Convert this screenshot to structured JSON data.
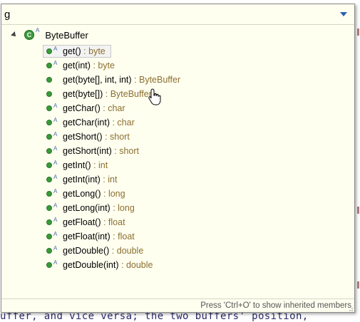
{
  "filter": {
    "value": "g"
  },
  "tree": {
    "root_label": "ByteBuffer",
    "items": [
      {
        "name": "get()",
        "sep": " : ",
        "type": "byte",
        "static": false,
        "selected": true
      },
      {
        "name": "get(int)",
        "sep": " : ",
        "type": "byte",
        "static": false,
        "selected": false
      },
      {
        "name": "get(byte[], int, int)",
        "sep": " : ",
        "type": "ByteBuffer",
        "static": true,
        "selected": false
      },
      {
        "name": "get(byte[])",
        "sep": " : ",
        "type": "ByteBuffer",
        "static": true,
        "selected": false
      },
      {
        "name": "getChar()",
        "sep": " : ",
        "type": "char",
        "static": false,
        "selected": false
      },
      {
        "name": "getChar(int)",
        "sep": " : ",
        "type": "char",
        "static": false,
        "selected": false
      },
      {
        "name": "getShort()",
        "sep": " : ",
        "type": "short",
        "static": false,
        "selected": false
      },
      {
        "name": "getShort(int)",
        "sep": " : ",
        "type": "short",
        "static": false,
        "selected": false
      },
      {
        "name": "getInt()",
        "sep": " : ",
        "type": "int",
        "static": false,
        "selected": false
      },
      {
        "name": "getInt(int)",
        "sep": " : ",
        "type": "int",
        "static": false,
        "selected": false
      },
      {
        "name": "getLong()",
        "sep": " : ",
        "type": "long",
        "static": false,
        "selected": false
      },
      {
        "name": "getLong(int)",
        "sep": " : ",
        "type": "long",
        "static": false,
        "selected": false
      },
      {
        "name": "getFloat()",
        "sep": " : ",
        "type": "float",
        "static": false,
        "selected": false
      },
      {
        "name": "getFloat(int)",
        "sep": " : ",
        "type": "float",
        "static": false,
        "selected": false
      },
      {
        "name": "getDouble()",
        "sep": " : ",
        "type": "double",
        "static": false,
        "selected": false
      },
      {
        "name": "getDouble(int)",
        "sep": " : ",
        "type": "double",
        "static": false,
        "selected": false
      }
    ]
  },
  "status": {
    "hint": "Press 'Ctrl+O' to show inherited members"
  },
  "background": {
    "bottom_text": "uffer, and vice versa; the two buffers' position,"
  },
  "colors": {
    "popup_bg": "#fffff0",
    "type_color": "#8b6f2e",
    "method_icon": "#3a9a3a",
    "accent": "#2d5fb0"
  }
}
